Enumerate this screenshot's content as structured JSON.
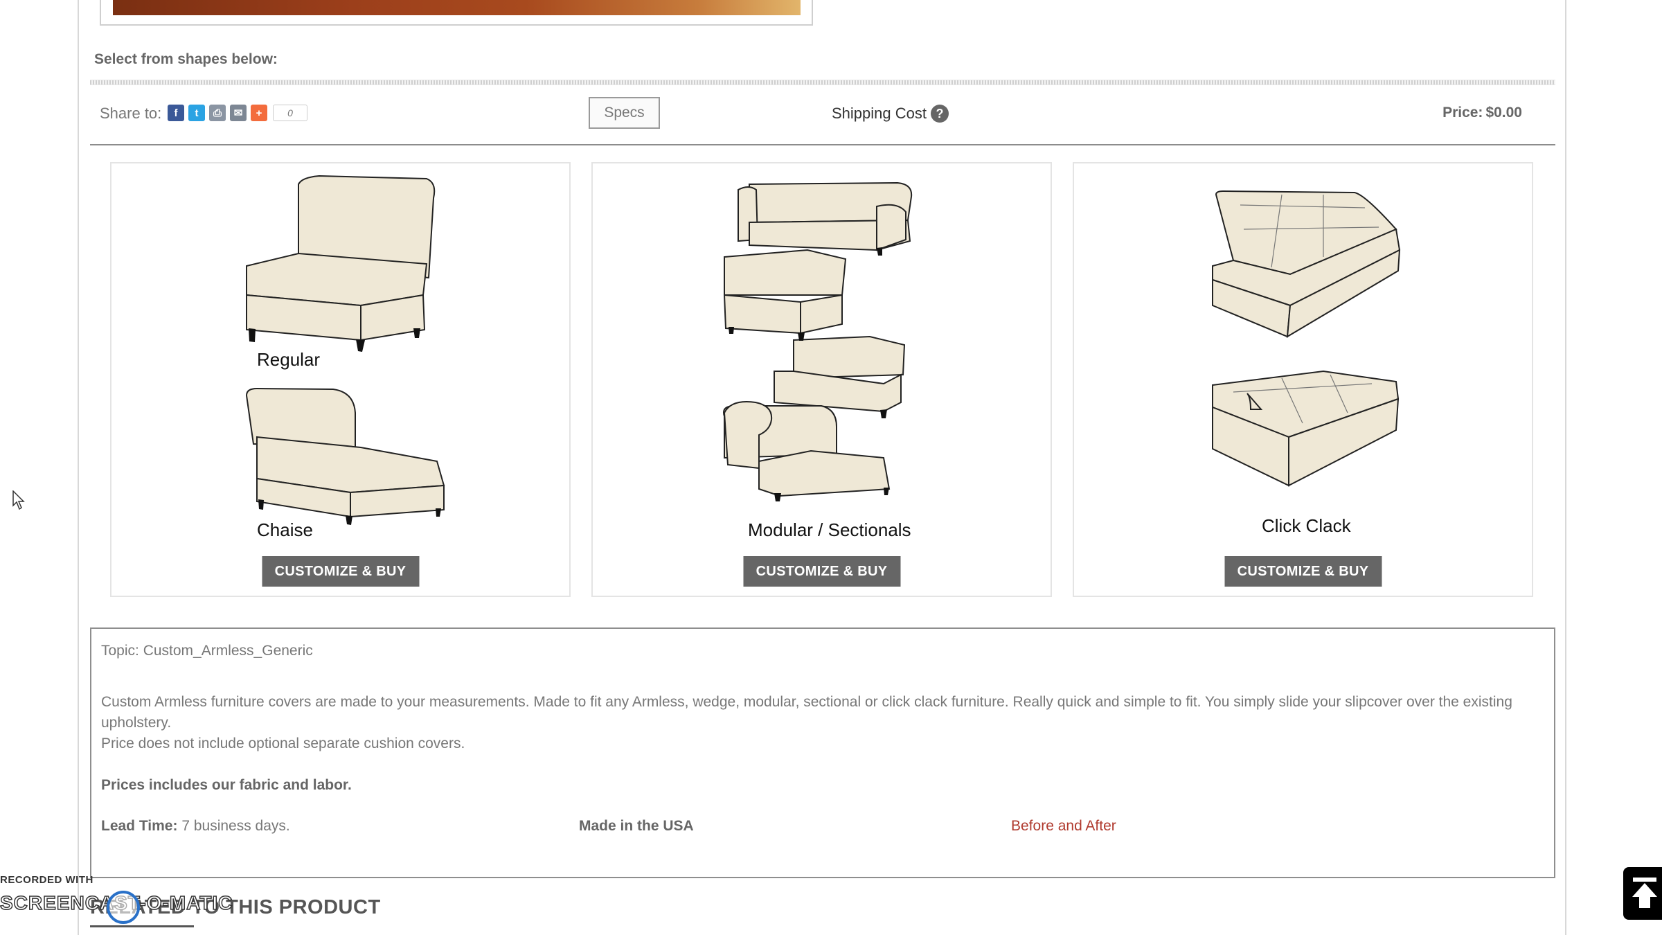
{
  "header": {
    "select_title": "Select from shapes below:"
  },
  "share": {
    "label": "Share to:",
    "icons": [
      "facebook-icon",
      "twitter-icon",
      "print-icon",
      "email-icon",
      "addthis-icon"
    ],
    "count": "0"
  },
  "toolbar": {
    "specs_label": "Specs",
    "shipping_label": "Shipping Cost",
    "price_label": "Price:",
    "price_value": "$0.00"
  },
  "cards": [
    {
      "labels": [
        "Regular",
        "Chaise"
      ],
      "button": "CUSTOMIZE & BUY"
    },
    {
      "labels": [
        "Modular / Sectionals"
      ],
      "button": "CUSTOMIZE & BUY"
    },
    {
      "labels": [
        "Click Clack"
      ],
      "button": "CUSTOMIZE & BUY"
    }
  ],
  "info": {
    "topic": "Topic: Custom_Armless_Generic",
    "description": "Custom Armless furniture covers are made to your measurements. Made to fit any Armless, wedge, modular, sectional or click clack furniture. Really quick and simple to fit. You simply slide your slipcover over the existing upholstery.",
    "price_note": "Price does not include optional separate cushion covers.",
    "fabric_note": "Prices includes our fabric and labor.",
    "lead_label": "Lead Time:",
    "lead_value": "7 business days.",
    "made_in": "Made in the USA",
    "before_after": "Before and After"
  },
  "related": {
    "title": "RELATED TO THIS PRODUCT"
  },
  "watermark": {
    "top": "RECORDED WITH",
    "brand": "SCREENCAST-O-MATIC"
  },
  "colors": {
    "button_bg": "#666666",
    "link_red": "#b03a2e",
    "facebook": "#3b5998",
    "twitter": "#2ba3e3",
    "addthis": "#f36c3d",
    "cushion_fill": "#efe8d6"
  }
}
